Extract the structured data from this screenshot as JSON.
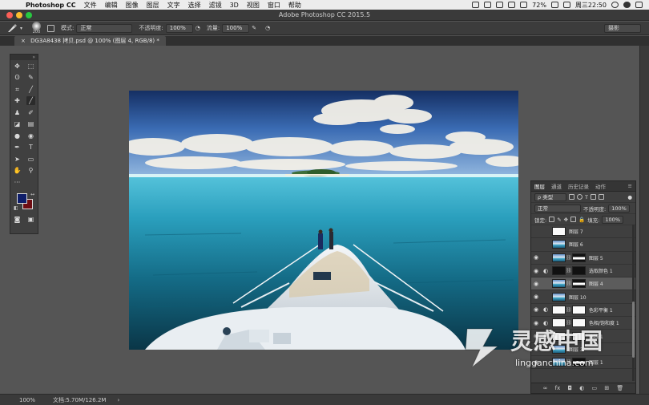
{
  "menubar": {
    "app_name": "Photoshop CC",
    "items": [
      "文件",
      "编辑",
      "图像",
      "图层",
      "文字",
      "选择",
      "滤镜",
      "3D",
      "视图",
      "窗口",
      "帮助"
    ],
    "battery": "72%",
    "clock": "周三22:50"
  },
  "window": {
    "title": "Adobe Photoshop CC 2015.5"
  },
  "options": {
    "brush_size": "200",
    "mode_label": "模式:",
    "mode_value": "正常",
    "opacity_label": "不透明度:",
    "opacity_value": "100%",
    "flow_label": "流量:",
    "flow_value": "100%",
    "workspace": "摄影"
  },
  "document": {
    "tab_title": "DG3A8438 拷贝.psd @ 100% (图层 4, RGB/8) *"
  },
  "colors": {
    "foreground": "#0f1e6a",
    "background": "#6e0c12"
  },
  "layers_panel": {
    "tabs": [
      "图层",
      "通道",
      "历史记录",
      "动作"
    ],
    "kind_filter": "类型",
    "blend_mode": "正常",
    "opacity_label": "不透明度:",
    "opacity_value": "100%",
    "lock_label": "锁定:",
    "fill_label": "填充:",
    "fill_value": "100%",
    "layers": [
      {
        "name": "图层 7",
        "thumb": "white",
        "visible": false,
        "adjust": false,
        "mask": false
      },
      {
        "name": "图层 6",
        "thumb": "sea",
        "visible": false,
        "adjust": false,
        "mask": false
      },
      {
        "name": "图层 5",
        "thumb": "sea",
        "visible": true,
        "adjust": false,
        "mask": true
      },
      {
        "name": "选取颜色 1",
        "thumb": "black",
        "visible": true,
        "adjust": true,
        "mask": false
      },
      {
        "name": "图层 4",
        "thumb": "sea",
        "visible": true,
        "adjust": false,
        "mask": true,
        "selected": true
      },
      {
        "name": "图层 10",
        "thumb": "sea",
        "visible": true,
        "adjust": false,
        "mask": false
      },
      {
        "name": "色彩平衡 1",
        "thumb": "white",
        "visible": true,
        "adjust": true,
        "mask": false
      },
      {
        "name": "色相/饱和度 1",
        "thumb": "white",
        "visible": true,
        "adjust": true,
        "mask": false
      },
      {
        "name": "曲线 1",
        "thumb": "white",
        "visible": true,
        "adjust": true,
        "mask": false
      },
      {
        "name": "图层 3",
        "thumb": "sea",
        "visible": true,
        "adjust": false,
        "mask": false
      },
      {
        "name": "图层 1",
        "thumb": "sea",
        "visible": true,
        "adjust": false,
        "mask": true
      }
    ]
  },
  "status": {
    "zoom": "100%",
    "doc_info": "文档:5.70M/126.2M",
    "arrow": "›"
  },
  "watermark": {
    "cn": "灵感中国",
    "en": "lingganchina.com"
  }
}
